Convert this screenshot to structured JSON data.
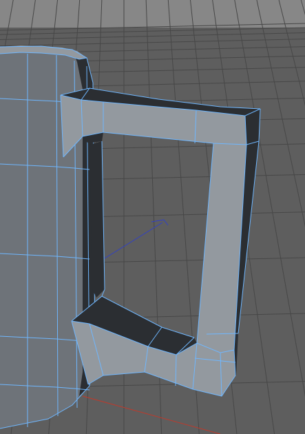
{
  "viewport": {
    "view": "perspective",
    "shading": "smooth",
    "wireframe_overlay": true,
    "grid_visible": true
  },
  "colors": {
    "background_sky": "#878787",
    "background_floor": "#5e5e5e",
    "grid_line": "#474747",
    "wire": "#6fb7ff",
    "mesh_light": "#93999f",
    "mesh_mid": "#6e7379",
    "mesh_dark": "#2b2e32",
    "axis_x": "#c0392b",
    "axis_z": "#2f3fc9"
  },
  "scene": {
    "objects": [
      {
        "name": "Mug",
        "type": "polygon-mesh",
        "parts": [
          "body",
          "handle"
        ]
      }
    ],
    "world_axes": [
      "x-axis",
      "z-axis"
    ]
  }
}
